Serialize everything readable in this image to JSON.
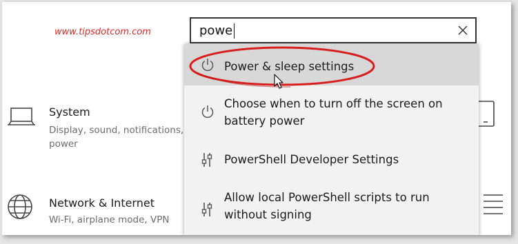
{
  "watermark": "www.tipsdotcom.com",
  "search": {
    "value": "powe",
    "clear_icon": "close-icon"
  },
  "tiles": {
    "system": {
      "title": "System",
      "description": "Display, sound, notifications, power",
      "icon": "laptop-icon"
    },
    "network": {
      "title": "Network & Internet",
      "description": "Wi-Fi, airplane mode, VPN",
      "icon": "globe-icon"
    }
  },
  "results": [
    {
      "label": "Power & sleep settings",
      "icon": "power-icon",
      "highlighted": true
    },
    {
      "label": "Choose when to turn off the screen on battery power",
      "icon": "power-icon",
      "highlighted": false
    },
    {
      "label": "PowerShell Developer Settings",
      "icon": "sliders-icon",
      "highlighted": false
    },
    {
      "label": "Allow local PowerShell scripts to run without signing",
      "icon": "sliders-icon",
      "highlighted": false
    }
  ],
  "colors": {
    "annotation_red": "#d81e1e",
    "highlight_bg": "#d8d8d8",
    "dropdown_bg": "#f2f2f2"
  }
}
